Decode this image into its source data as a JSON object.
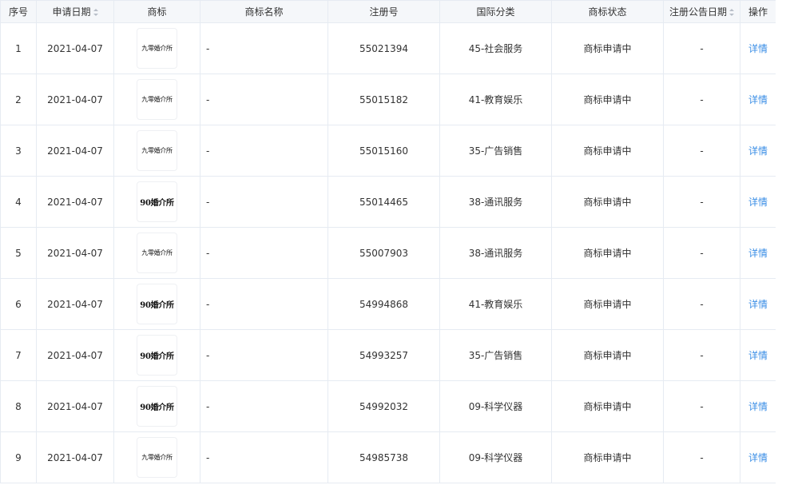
{
  "table": {
    "headers": {
      "index": "序号",
      "apply_date": "申请日期",
      "logo": "商标",
      "name": "商标名称",
      "reg_no": "注册号",
      "class": "国际分类",
      "status": "商标状态",
      "announce_date": "注册公告日期",
      "action": "操作"
    },
    "rows": [
      {
        "index": "1",
        "apply_date": "2021-04-07",
        "logo_text": "九零婚介所",
        "logo_style": "a",
        "name": "-",
        "reg_no": "55021394",
        "class": "45-社会服务",
        "status": "商标申请中",
        "announce_date": "-",
        "action": "详情"
      },
      {
        "index": "2",
        "apply_date": "2021-04-07",
        "logo_text": "九零婚介所",
        "logo_style": "a",
        "name": "-",
        "reg_no": "55015182",
        "class": "41-教育娱乐",
        "status": "商标申请中",
        "announce_date": "-",
        "action": "详情"
      },
      {
        "index": "3",
        "apply_date": "2021-04-07",
        "logo_text": "九零婚介所",
        "logo_style": "a",
        "name": "-",
        "reg_no": "55015160",
        "class": "35-广告销售",
        "status": "商标申请中",
        "announce_date": "-",
        "action": "详情"
      },
      {
        "index": "4",
        "apply_date": "2021-04-07",
        "logo_text": "90婚介所",
        "logo_style": "b",
        "name": "-",
        "reg_no": "55014465",
        "class": "38-通讯服务",
        "status": "商标申请中",
        "announce_date": "-",
        "action": "详情"
      },
      {
        "index": "5",
        "apply_date": "2021-04-07",
        "logo_text": "九零婚介所",
        "logo_style": "a",
        "name": "-",
        "reg_no": "55007903",
        "class": "38-通讯服务",
        "status": "商标申请中",
        "announce_date": "-",
        "action": "详情"
      },
      {
        "index": "6",
        "apply_date": "2021-04-07",
        "logo_text": "90婚介所",
        "logo_style": "b",
        "name": "-",
        "reg_no": "54994868",
        "class": "41-教育娱乐",
        "status": "商标申请中",
        "announce_date": "-",
        "action": "详情"
      },
      {
        "index": "7",
        "apply_date": "2021-04-07",
        "logo_text": "90婚介所",
        "logo_style": "b",
        "name": "-",
        "reg_no": "54993257",
        "class": "35-广告销售",
        "status": "商标申请中",
        "announce_date": "-",
        "action": "详情"
      },
      {
        "index": "8",
        "apply_date": "2021-04-07",
        "logo_text": "90婚介所",
        "logo_style": "b",
        "name": "-",
        "reg_no": "54992032",
        "class": "09-科学仪器",
        "status": "商标申请中",
        "announce_date": "-",
        "action": "详情"
      },
      {
        "index": "9",
        "apply_date": "2021-04-07",
        "logo_text": "九零婚介所",
        "logo_style": "a",
        "name": "-",
        "reg_no": "54985738",
        "class": "09-科学仪器",
        "status": "商标申请中",
        "announce_date": "-",
        "action": "详情"
      }
    ]
  },
  "colors": {
    "header_bg": "#f5f7fa",
    "border": "#e6ebf2",
    "link": "#3a8ee6",
    "text": "#333333"
  }
}
